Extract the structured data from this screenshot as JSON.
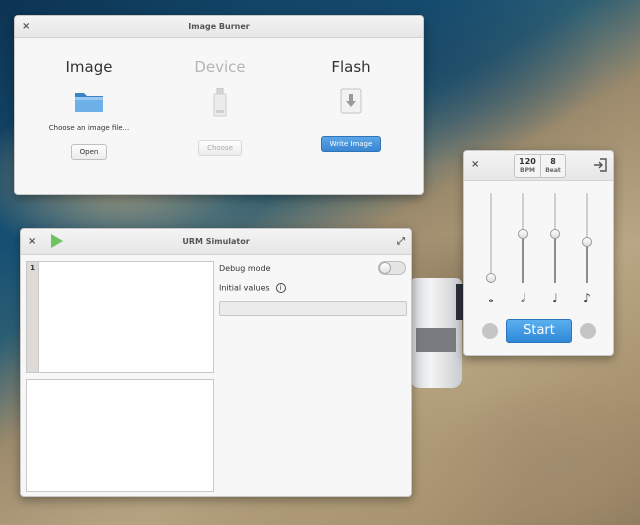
{
  "image_burner": {
    "title": "Image Burner",
    "close_glyph": "×",
    "columns": [
      {
        "heading": "Image",
        "icon": "folder-icon",
        "caption": "Choose an image file...",
        "button": "Open"
      },
      {
        "heading": "Device",
        "icon": "usb-drive-icon",
        "caption": "",
        "button": "Choose"
      },
      {
        "heading": "Flash",
        "icon": "download-arrow-icon",
        "caption": "",
        "button": "Write Image"
      }
    ]
  },
  "metronome": {
    "close_glyph": "×",
    "bpm_value": "120",
    "bpm_label": "BPM",
    "beat_value": "8",
    "beat_label": "Beat",
    "start_label": "Start",
    "sliders": [
      {
        "note": "whole-note-icon",
        "glyph": "𝅝",
        "level": 0.0
      },
      {
        "note": "half-note-icon",
        "glyph": "𝅗𝅥",
        "level": 0.55
      },
      {
        "note": "quarter-note-icon",
        "glyph": "♩",
        "level": 0.55
      },
      {
        "note": "eighth-note-icon",
        "glyph": "♪",
        "level": 0.45
      }
    ]
  },
  "urm": {
    "title": "URM Simulator",
    "close_glyph": "×",
    "expand_glyph": "⤢",
    "line_number": "1",
    "debug_label": "Debug mode",
    "debug_on": false,
    "initial_values_label": "Initial values",
    "info_glyph": "i",
    "initial_values_value": ""
  }
}
